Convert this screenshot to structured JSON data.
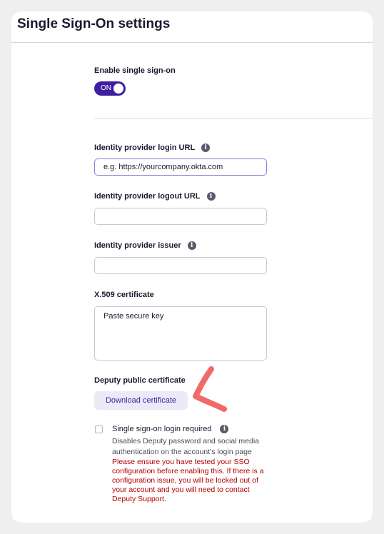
{
  "page_title": "Single Sign-On settings",
  "sso_toggle": {
    "label": "Enable single sign-on",
    "state_text": "ON"
  },
  "fields": {
    "login_url": {
      "label": "Identity provider login URL",
      "value": "e.g. https://yourcompany.okta.com"
    },
    "logout_url": {
      "label": "Identity provider logout URL",
      "value": ""
    },
    "issuer": {
      "label": "Identity provider issuer",
      "value": ""
    },
    "certificate": {
      "label": "X.509 certificate",
      "value": "Paste secure key"
    }
  },
  "deputy_cert": {
    "label": "Deputy public certificate",
    "button_label": "Download certificate"
  },
  "login_required": {
    "label": "Single sign-on login required",
    "description": "Disables Deputy password and social media authentication on the account's login page",
    "warning": "Please ensure you have tested your SSO configuration before enabling this. If there is a configuration issue, you will be locked out of your account and you will need to contact Deputy Support."
  },
  "icons": {
    "info": "info-icon",
    "annotation": "arrow-annotation"
  },
  "colors": {
    "accent": "#3f1fa0",
    "warning": "#b30000",
    "annotation": "#f06a6a"
  }
}
